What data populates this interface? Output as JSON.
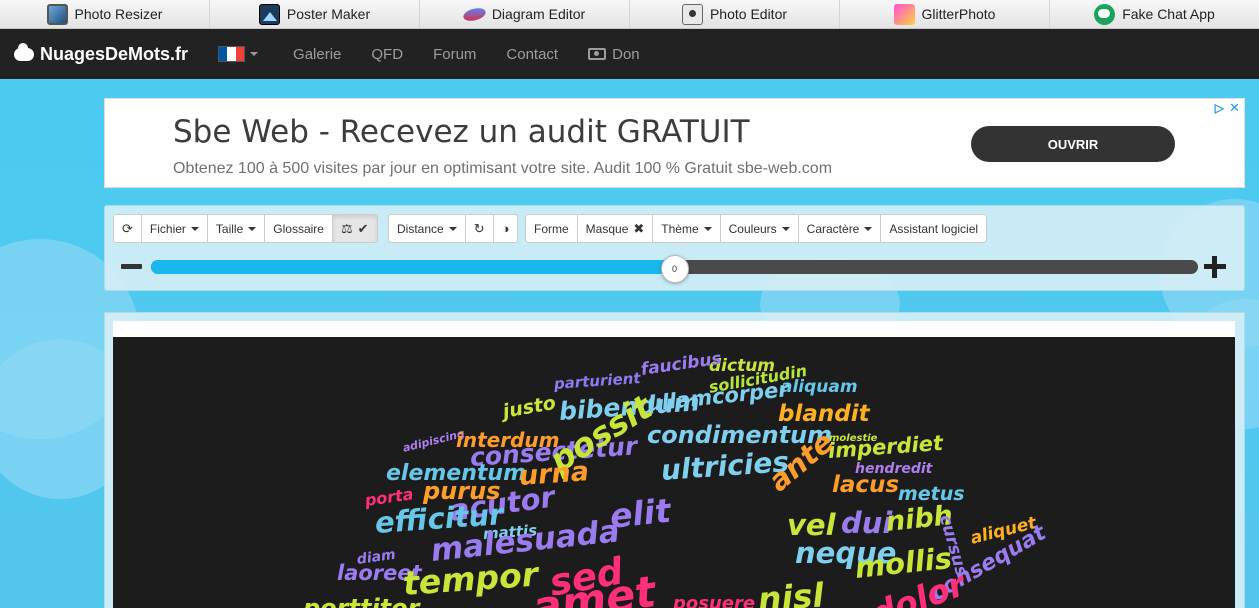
{
  "appbar": {
    "items": [
      {
        "label": "Photo Resizer",
        "icon": "photo-resizer-icon"
      },
      {
        "label": "Poster Maker",
        "icon": "poster-maker-icon"
      },
      {
        "label": "Diagram Editor",
        "icon": "diagram-editor-icon"
      },
      {
        "label": "Photo Editor",
        "icon": "photo-editor-icon"
      },
      {
        "label": "GlitterPhoto",
        "icon": "glitterphoto-icon"
      },
      {
        "label": "Fake Chat App",
        "icon": "fake-chat-app-icon"
      }
    ]
  },
  "navbar": {
    "brand": "NuagesDeMots.fr",
    "language": "French",
    "links": [
      "Galerie",
      "QFD",
      "Forum",
      "Contact"
    ],
    "donate": "Don"
  },
  "ad": {
    "title": "Sbe Web - Recevez un audit GRATUIT",
    "description": "Obtenez 100 à 500 visites par jour en optimisant votre site. Audit 100 % Gratuit sbe-web.com",
    "button": "OUVRIR",
    "adchoices_icon": "▷",
    "close_icon": "✕"
  },
  "toolbar": {
    "refresh_icon": "⟳",
    "fichier": "Fichier",
    "taille": "Taille",
    "glossaire": "Glossaire",
    "balance_icon": "⚖",
    "check_icon": "✔",
    "distance": "Distance",
    "redo_icon": "↻",
    "contrast_icon": "◑",
    "forme": "Forme",
    "masque": "Masque",
    "masque_remove_icon": "✖",
    "theme": "Thème",
    "couleurs": "Couleurs",
    "caractere": "Caractère",
    "assistant": "Assistant logiciel"
  },
  "slider": {
    "value": "0",
    "fill_fraction": 0.5
  },
  "cloud": {
    "background": "#1c1c1c",
    "words": [
      {
        "text": "dictum",
        "color": "#c8e63a"
      },
      {
        "text": "faucibus",
        "color": "#9b7cf0"
      },
      {
        "text": "parturient",
        "color": "#8a7cf0"
      },
      {
        "text": "sollicitudin",
        "color": "#b6e639"
      },
      {
        "text": "aliquam",
        "color": "#66c7e8"
      },
      {
        "text": "ullamcorper",
        "color": "#7fd0ef"
      },
      {
        "text": "justo",
        "color": "#c8e63a"
      },
      {
        "text": "bibendum",
        "color": "#7fd0ef"
      },
      {
        "text": "blandit",
        "color": "#ffb020"
      },
      {
        "text": "condimentum",
        "color": "#7fd0ef"
      },
      {
        "text": "molestie",
        "color": "#c8e63a"
      },
      {
        "text": "adipiscing",
        "color": "#b07ef0"
      },
      {
        "text": "interdum",
        "color": "#ff9d2a"
      },
      {
        "text": "consectetur",
        "color": "#9b7cf0"
      },
      {
        "text": "possit",
        "color": "#c8e63a"
      },
      {
        "text": "imperdiet",
        "color": "#c8e63a"
      },
      {
        "text": "hendredit",
        "color": "#b07ef0"
      },
      {
        "text": "elementum",
        "color": "#66c7e8"
      },
      {
        "text": "urna",
        "color": "#ff9d2a"
      },
      {
        "text": "ultricies",
        "color": "#7fd0ef"
      },
      {
        "text": "ante",
        "color": "#ff9d2a"
      },
      {
        "text": "lacus",
        "color": "#ff9d2a"
      },
      {
        "text": "metus",
        "color": "#66c7e8"
      },
      {
        "text": "porta",
        "color": "#ff2f7a"
      },
      {
        "text": "purus",
        "color": "#ff9d2a"
      },
      {
        "text": "acutor",
        "color": "#9b7cf0"
      },
      {
        "text": "elit",
        "color": "#9b7cf0"
      },
      {
        "text": "vel",
        "color": "#c8e63a"
      },
      {
        "text": "dui",
        "color": "#9b7cf0"
      },
      {
        "text": "nibh",
        "color": "#c8e63a"
      },
      {
        "text": "cursus",
        "color": "#9b7cf0"
      },
      {
        "text": "efficitur",
        "color": "#66c7e8"
      },
      {
        "text": "mattis",
        "color": "#7fd0ef"
      },
      {
        "text": "aliquet",
        "color": "#ffb020"
      },
      {
        "text": "malesuada",
        "color": "#9b7cf0"
      },
      {
        "text": "neque",
        "color": "#7fd0ef"
      },
      {
        "text": "diam",
        "color": "#9b7cf0"
      },
      {
        "text": "laoreet",
        "color": "#9b7cf0"
      },
      {
        "text": "tempor",
        "color": "#c8e63a"
      },
      {
        "text": "sed",
        "color": "#ff2f7a"
      },
      {
        "text": "mollis",
        "color": "#c8e63a"
      },
      {
        "text": "nisl",
        "color": "#c8e63a"
      },
      {
        "text": "consequat",
        "color": "#9b7cf0"
      },
      {
        "text": "porttitor",
        "color": "#c8e63a"
      },
      {
        "text": "posuere",
        "color": "#ff2f7a"
      },
      {
        "text": "amet",
        "color": "#ff2f7a"
      },
      {
        "text": "dolor",
        "color": "#ff2f7a"
      }
    ]
  }
}
